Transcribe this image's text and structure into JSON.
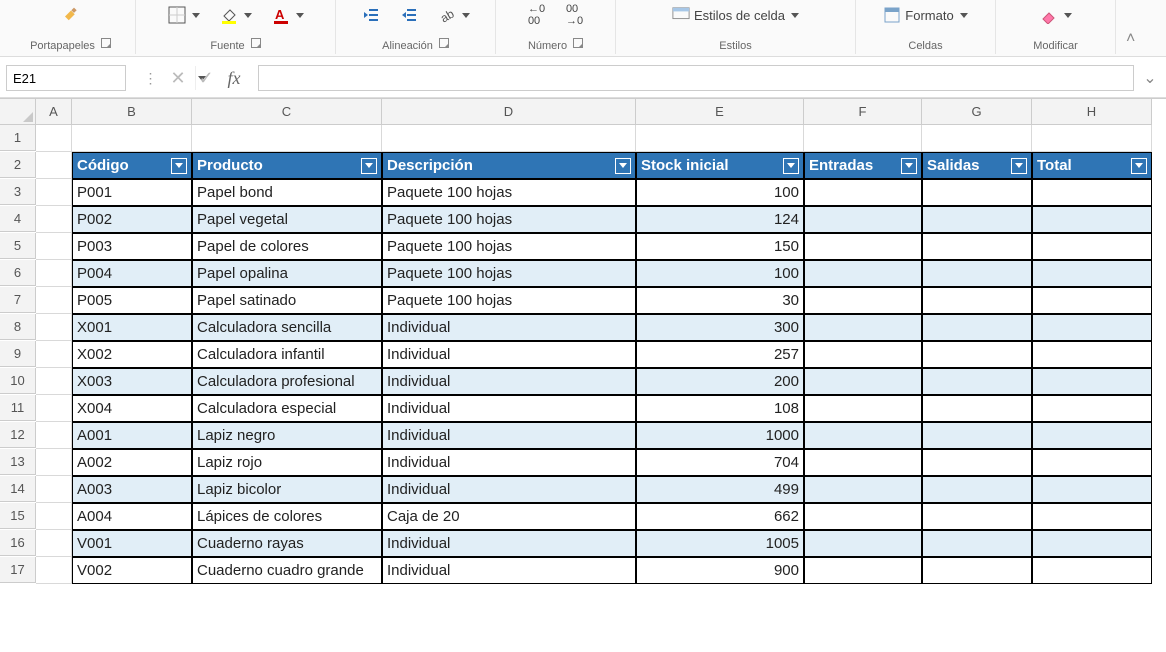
{
  "ribbon": {
    "groups": {
      "clipboard": "Portapapeles",
      "font": "Fuente",
      "alignment": "Alineación",
      "number": "Número",
      "styles": "Estilos",
      "cells": "Celdas",
      "editing": "Modificar"
    },
    "buttons": {
      "cell_styles": "Estilos de celda",
      "format": "Formato"
    }
  },
  "namebox": {
    "value": "E21"
  },
  "formula": {
    "value": ""
  },
  "columns": [
    "A",
    "B",
    "C",
    "D",
    "E",
    "F",
    "G",
    "H"
  ],
  "row_numbers": [
    1,
    2,
    3,
    4,
    5,
    6,
    7,
    8,
    9,
    10,
    11,
    12,
    13,
    14,
    15,
    16,
    17
  ],
  "table": {
    "headers": [
      "Código",
      "Producto",
      "Descripción",
      "Stock inicial",
      "Entradas",
      "Salidas",
      "Total"
    ],
    "rows": [
      {
        "codigo": "P001",
        "producto": "Papel bond",
        "descripcion": "Paquete 100 hojas",
        "stock": 100,
        "entradas": "",
        "salidas": "",
        "total": ""
      },
      {
        "codigo": "P002",
        "producto": "Papel vegetal",
        "descripcion": "Paquete 100 hojas",
        "stock": 124,
        "entradas": "",
        "salidas": "",
        "total": ""
      },
      {
        "codigo": "P003",
        "producto": "Papel de colores",
        "descripcion": "Paquete 100 hojas",
        "stock": 150,
        "entradas": "",
        "salidas": "",
        "total": ""
      },
      {
        "codigo": "P004",
        "producto": "Papel opalina",
        "descripcion": "Paquete 100 hojas",
        "stock": 100,
        "entradas": "",
        "salidas": "",
        "total": ""
      },
      {
        "codigo": "P005",
        "producto": "Papel satinado",
        "descripcion": "Paquete 100 hojas",
        "stock": 30,
        "entradas": "",
        "salidas": "",
        "total": ""
      },
      {
        "codigo": "X001",
        "producto": "Calculadora sencilla",
        "descripcion": "Individual",
        "stock": 300,
        "entradas": "",
        "salidas": "",
        "total": ""
      },
      {
        "codigo": "X002",
        "producto": "Calculadora infantil",
        "descripcion": "Individual",
        "stock": 257,
        "entradas": "",
        "salidas": "",
        "total": ""
      },
      {
        "codigo": "X003",
        "producto": "Calculadora profesional",
        "descripcion": "Individual",
        "stock": 200,
        "entradas": "",
        "salidas": "",
        "total": ""
      },
      {
        "codigo": "X004",
        "producto": "Calculadora especial",
        "descripcion": "Individual",
        "stock": 108,
        "entradas": "",
        "salidas": "",
        "total": ""
      },
      {
        "codigo": "A001",
        "producto": "Lapiz negro",
        "descripcion": "Individual",
        "stock": 1000,
        "entradas": "",
        "salidas": "",
        "total": ""
      },
      {
        "codigo": "A002",
        "producto": "Lapiz rojo",
        "descripcion": "Individual",
        "stock": 704,
        "entradas": "",
        "salidas": "",
        "total": ""
      },
      {
        "codigo": "A003",
        "producto": "Lapiz bicolor",
        "descripcion": "Individual",
        "stock": 499,
        "entradas": "",
        "salidas": "",
        "total": ""
      },
      {
        "codigo": "A004",
        "producto": "Lápices de colores",
        "descripcion": "Caja de 20",
        "stock": 662,
        "entradas": "",
        "salidas": "",
        "total": ""
      },
      {
        "codigo": "V001",
        "producto": "Cuaderno rayas",
        "descripcion": "Individual",
        "stock": 1005,
        "entradas": "",
        "salidas": "",
        "total": ""
      },
      {
        "codigo": "V002",
        "producto": "Cuaderno cuadro grande",
        "descripcion": "Individual",
        "stock": 900,
        "entradas": "",
        "salidas": "",
        "total": ""
      }
    ]
  }
}
